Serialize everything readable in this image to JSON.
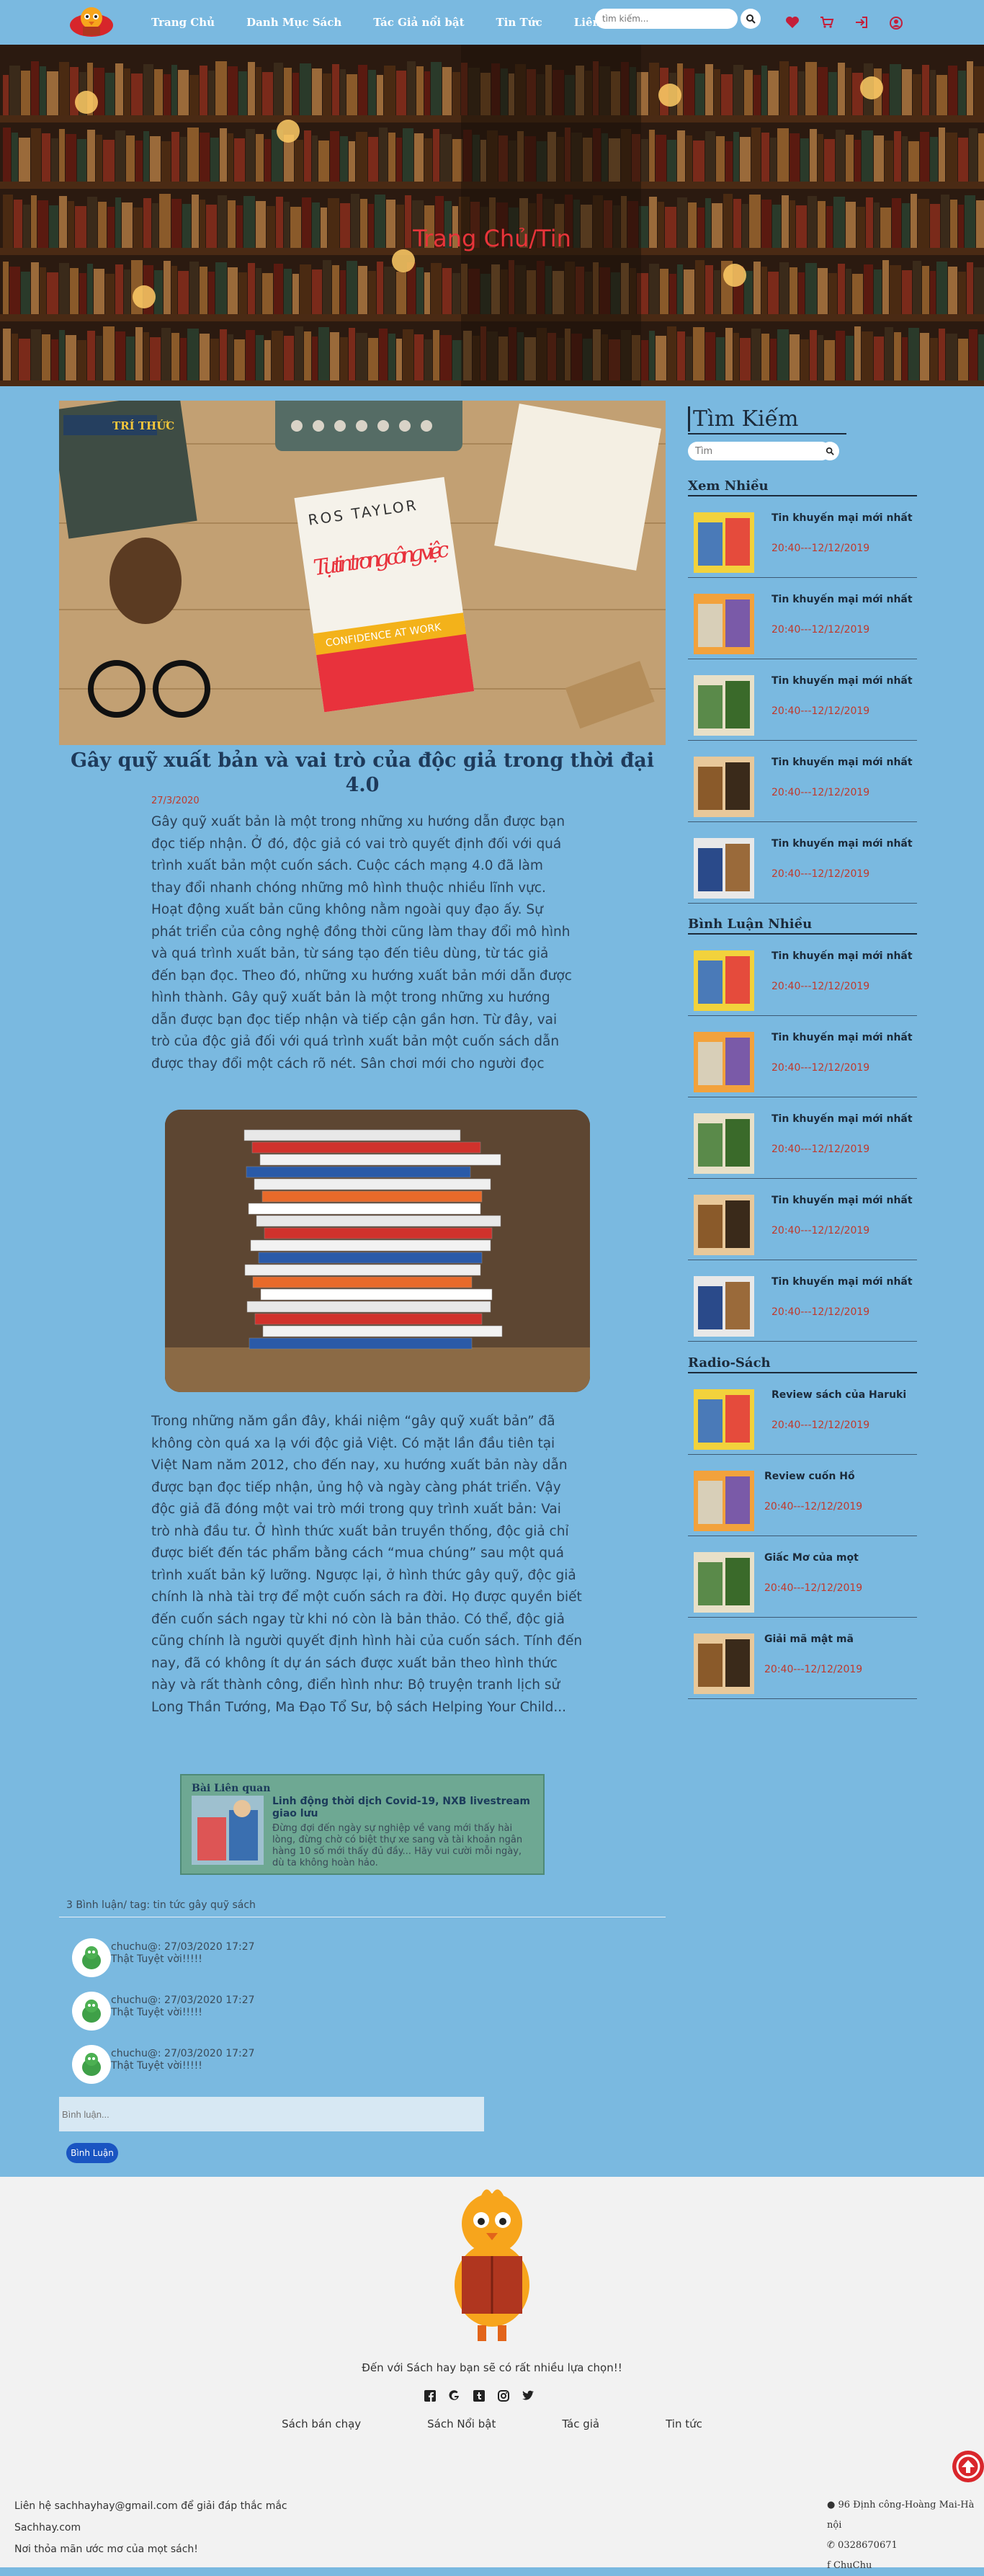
{
  "nav": {
    "menu": [
      "Trang Chủ",
      "Danh Mục Sách",
      "Tác Giả nổi bật",
      "Tin Tức",
      "Liên Hệ"
    ],
    "search_placeholder": "tìm kiếm..."
  },
  "hero": {
    "title": "Trang Chủ/Tin"
  },
  "article": {
    "feature_brand": "TRÍ THỨC",
    "book_author": "ROS TAYLOR",
    "book_title": "Tự tin trong công việc",
    "book_subtitle": "CONFIDENCE AT WORK",
    "title": "Gây quỹ xuất bản và vai trò của độc giả trong thời đại 4.0",
    "date": "27/3/2020",
    "body1": "Gây quỹ xuất bản là một trong những xu hướng dẫn được bạn đọc tiếp nhận. Ở đó, độc giả có vai trò quyết định đối với quá trình xuất bản một cuốn sách. Cuộc cách mạng 4.0 đã làm thay đổi nhanh chóng những mô hình thuộc nhiều lĩnh vực. Hoạt động xuất bản cũng không nằm ngoài quy đạo ấy. Sự phát triển của công nghệ đồng thời cũng làm thay đổi mô hình và quá trình xuất bản, từ sáng tạo đến tiêu dùng, từ tác giả đến bạn đọc. Theo đó, những xu hướng xuất bản mới dẫn được hình thành. Gây quỹ xuất bản là một trong những xu hướng dẫn được bạn đọc tiếp nhận và tiếp cận gần hơn. Từ đây, vai trò của độc giả đối với quá trình xuất bản một cuốn sách dẫn được thay đổi một cách rõ nét. Sân chơi mới cho người đọc",
    "body2": "Trong những năm gần đây, khái niệm “gây quỹ xuất bản” đã không còn quá xa lạ với độc giả Việt. Có mặt lần đầu tiên tại Việt Nam năm 2012, cho đến nay, xu hướng xuất bản này dẫn được bạn đọc tiếp nhận, ủng hộ và ngày càng phát triển. Vậy độc giả đã đóng một vai trò mới trong quy trình xuất bản: Vai trò nhà đầu tư. Ở hình thức xuất bản truyền thống, độc giả chỉ được biết đến tác phẩm bằng cách “mua chúng” sau một quá trình xuất bản kỹ lưỡng. Ngược lại, ở hình thức gây quỹ, độc giả chính là nhà tài trợ để một cuốn sách ra đời. Họ được quyền biết đến cuốn sách ngay từ khi nó còn là bản thảo. Có thể, độc giả cũng chính là người quyết định hình hài của cuốn sách. Tính đến nay, đã có không ít dự án sách được xuất bản theo hình thức này và rất thành công, điển hình như: Bộ truyện tranh lịch sử Long Thần Tướng, Ma Đạo Tổ Sư, bộ sách Helping Your Child..."
  },
  "related": {
    "heading": "Bài Liên quan",
    "title": "Linh động thời dịch Covid-19, NXB livestream giao lưu",
    "desc": "Đừng đợi đến ngày sự nghiệp về vang mới thấy hài lòng, đừng chờ có biệt thự xe sang và tài khoản ngân hàng 10 số mới thấy đủ đầy... Hãy vui cười mỗi ngày, dù ta không hoàn hảo."
  },
  "comments": {
    "meta": "3 Bình luận/ tag: tin tức gây quỹ sách",
    "items": [
      {
        "meta": "chuchu@: 27/03/2020    17:27",
        "text": "Thật Tuyệt vời!!!!!"
      },
      {
        "meta": "chuchu@: 27/03/2020    17:27",
        "text": "Thật Tuyệt vời!!!!!"
      },
      {
        "meta": "chuchu@: 27/03/2020    17:27",
        "text": "Thật Tuyệt vời!!!!!"
      }
    ],
    "input_placeholder": "Bình luận...",
    "submit": "Bình Luận"
  },
  "sidebar": {
    "search_title": "Tìm Kiếm",
    "search_placeholder": "Tìm",
    "sections": [
      {
        "title": "Xem Nhiều",
        "items": [
          {
            "title": "Tin khuyến mại mới nhất",
            "date": "20:40---12/12/2019"
          },
          {
            "title": "Tin khuyến mại mới nhất",
            "date": "20:40---12/12/2019"
          },
          {
            "title": "Tin khuyến mại mới nhất",
            "date": "20:40---12/12/2019"
          },
          {
            "title": "Tin khuyến mại mới nhất",
            "date": "20:40---12/12/2019"
          },
          {
            "title": "Tin khuyến mại mới nhất",
            "date": "20:40---12/12/2019"
          }
        ]
      },
      {
        "title": "Bình Luận Nhiều",
        "items": [
          {
            "title": "Tin khuyến mại mới nhất",
            "date": "20:40---12/12/2019"
          },
          {
            "title": "Tin khuyến mại mới nhất",
            "date": "20:40---12/12/2019"
          },
          {
            "title": "Tin khuyến mại mới nhất",
            "date": "20:40---12/12/2019"
          },
          {
            "title": "Tin khuyến mại mới nhất",
            "date": "20:40---12/12/2019"
          },
          {
            "title": "Tin khuyến mại mới nhất",
            "date": "20:40---12/12/2019"
          }
        ]
      },
      {
        "title": "Radio-Sách",
        "items": [
          {
            "title": "Review sách của Haruki",
            "date": "20:40---12/12/2019"
          },
          {
            "title": "Review cuốn Hồ",
            "date": "20:40---12/12/2019"
          },
          {
            "title": "Giấc Mơ của mọt",
            "date": "20:40---12/12/2019"
          },
          {
            "title": "Giải mã mật mã",
            "date": "20:40---12/12/2019"
          }
        ]
      }
    ]
  },
  "footer": {
    "tagline": "Đến với Sách hay bạn sẽ có rất nhiều lựa chọn!!",
    "links": [
      "Sách bán chạy",
      "Sách Nổi bật",
      "Tác giả",
      "Tin tức"
    ],
    "contact": [
      "Liên hệ sachhayhay@gmail.com để giải đáp thắc mắc",
      "Sachhay.com",
      "Nơi thỏa mãn ước mơ của mọt sách!"
    ],
    "address": "96 Định công-Hoàng Mai-Hà nội",
    "phone": "0328670671",
    "facebook": "ChuChu"
  },
  "colors": {
    "page_bg": "#7ab9e0",
    "accent_red": "#c0392b",
    "footer_bg": "#f2f2f2",
    "button_blue": "#1a55c2"
  }
}
